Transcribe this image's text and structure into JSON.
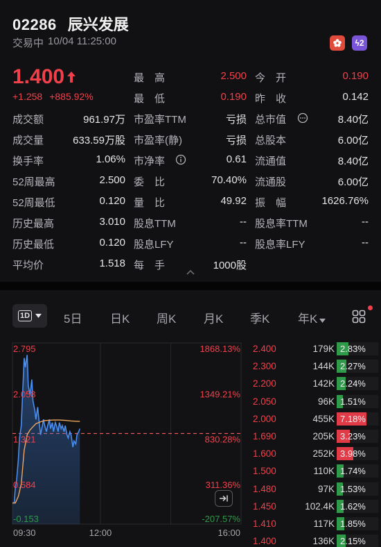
{
  "header": {
    "code": "02286",
    "name": "辰兴发展",
    "status": "交易中",
    "datetime": "10/04 11:25:00",
    "price": "1.400",
    "change": "+1.258",
    "change_pct": "+885.92%",
    "colors": {
      "up": "#f2404b",
      "down": "#2e9a4a",
      "badge_hk": "#e24b3c",
      "badge_lightning": "#7a55d8"
    }
  },
  "stats": {
    "col1": [
      {
        "label": "成交额",
        "value": "961.97万"
      },
      {
        "label": "成交量",
        "value": "633.59万股"
      },
      {
        "label": "换手率",
        "value": "1.06%"
      },
      {
        "label": "52周最高",
        "value": "2.500"
      },
      {
        "label": "52周最低",
        "value": "0.120"
      },
      {
        "label": "历史最高",
        "value": "3.010"
      },
      {
        "label": "历史最低",
        "value": "0.120"
      },
      {
        "label": "平均价",
        "value": "1.518"
      }
    ],
    "col2": [
      {
        "label": "最　高",
        "value": "2.500"
      },
      {
        "label": "最　低",
        "value": "0.190"
      },
      {
        "label": "市盈率TTM",
        "value": "亏损"
      },
      {
        "label": "市盈率(静)",
        "value": "亏损"
      },
      {
        "label": "市净率",
        "value": "0.61"
      },
      {
        "label": "委　比",
        "value": "70.40%"
      },
      {
        "label": "量　比",
        "value": "49.92"
      },
      {
        "label": "股息TTM",
        "value": "--"
      },
      {
        "label": "股息LFY",
        "value": "--"
      },
      {
        "label": "每　手",
        "value": "1000股"
      }
    ],
    "col3": [
      {
        "label": "今　开",
        "value": "0.190"
      },
      {
        "label": "昨　收",
        "value": "0.142"
      },
      {
        "label": "总市值",
        "value": "8.40亿"
      },
      {
        "label": "总股本",
        "value": "6.00亿"
      },
      {
        "label": "流通值",
        "value": "8.40亿"
      },
      {
        "label": "流通股",
        "value": "6.00亿"
      },
      {
        "label": "振　幅",
        "value": "1626.76%"
      },
      {
        "label": "股息率TTM",
        "value": "--"
      },
      {
        "label": "股息率LFY",
        "value": "--"
      }
    ]
  },
  "tabs": {
    "selected": "1D",
    "items": [
      "5日",
      "日K",
      "周K",
      "月K",
      "季K",
      "年K"
    ]
  },
  "chart_data": {
    "type": "line",
    "y_labels_left": [
      "2.795",
      "2.058",
      "1.321",
      "0.584",
      "-0.153"
    ],
    "y_labels_right": [
      "1868.13%",
      "1349.21%",
      "830.28%",
      "311.36%",
      "-207.57%"
    ],
    "x_labels": [
      "09:30",
      "12:00",
      "16:00"
    ],
    "ylim": [
      -0.153,
      2.795
    ],
    "prev_close": 1.321,
    "series": [
      {
        "x": [
          "09:30",
          "09:33",
          "09:35",
          "09:37",
          "09:40",
          "09:42",
          "09:45",
          "09:47",
          "09:50",
          "09:52",
          "09:55",
          "09:57",
          "10:00",
          "10:03",
          "10:05",
          "10:08",
          "10:10",
          "10:13",
          "10:15",
          "10:18",
          "10:20",
          "10:23",
          "10:25",
          "10:28",
          "10:30",
          "10:33",
          "10:35",
          "10:38",
          "10:40",
          "10:43",
          "10:45",
          "10:48",
          "10:50",
          "10:53",
          "10:55",
          "10:58",
          "11:00",
          "11:03",
          "11:05",
          "11:08",
          "11:10",
          "11:13",
          "11:15",
          "11:18",
          "11:20",
          "11:23",
          "11:25"
        ],
        "values": [
          0.19,
          0.19,
          0.45,
          0.55,
          0.9,
          1.25,
          1.45,
          1.9,
          2.55,
          2.4,
          2.6,
          2.1,
          1.95,
          2.2,
          1.85,
          1.7,
          1.55,
          1.75,
          1.55,
          1.3,
          1.4,
          1.55,
          1.45,
          1.35,
          1.45,
          1.55,
          1.4,
          1.5,
          1.35,
          1.5,
          1.45,
          1.35,
          1.5,
          1.4,
          1.45,
          1.35,
          1.45,
          1.3,
          1.25,
          1.35,
          1.3,
          1.1,
          1.2,
          1.15,
          1.3,
          1.35,
          1.4
        ]
      },
      {
        "x": [
          "09:30",
          "09:35",
          "09:40",
          "09:45",
          "09:50",
          "09:55",
          "10:00",
          "10:05",
          "10:10",
          "10:15",
          "10:20",
          "10:25",
          "10:30",
          "10:40",
          "10:50",
          "11:00",
          "11:10",
          "11:20",
          "11:25"
        ],
        "values": [
          0.19,
          0.19,
          0.3,
          0.5,
          1.05,
          1.3,
          1.38,
          1.43,
          1.48,
          1.5,
          1.52,
          1.53,
          1.535,
          1.54,
          1.54,
          1.535,
          1.525,
          1.52,
          1.518
        ]
      }
    ]
  },
  "order_book": [
    {
      "price": "2.400",
      "volume": "179K",
      "pct": "2.83%",
      "fill": 0.28
    },
    {
      "price": "2.300",
      "volume": "144K",
      "pct": "2.27%",
      "fill": 0.23
    },
    {
      "price": "2.200",
      "volume": "142K",
      "pct": "2.24%",
      "fill": 0.22
    },
    {
      "price": "2.050",
      "volume": "96K",
      "pct": "1.51%",
      "fill": 0.15
    },
    {
      "price": "2.000",
      "volume": "455K",
      "pct": "7.18%",
      "fill": 0.72
    },
    {
      "price": "1.690",
      "volume": "205K",
      "pct": "3.23%",
      "fill": 0.32
    },
    {
      "price": "1.600",
      "volume": "252K",
      "pct": "3.98%",
      "fill": 0.4
    },
    {
      "price": "1.500",
      "volume": "110K",
      "pct": "1.74%",
      "fill": 0.17
    },
    {
      "price": "1.480",
      "volume": "97K",
      "pct": "1.53%",
      "fill": 0.15
    },
    {
      "price": "1.450",
      "volume": "102.4K",
      "pct": "1.62%",
      "fill": 0.16
    },
    {
      "price": "1.410",
      "volume": "117K",
      "pct": "1.85%",
      "fill": 0.19
    },
    {
      "price": "1.400",
      "volume": "136K",
      "pct": "2.15%",
      "fill": 0.21
    }
  ],
  "icons": {
    "badge_hk": "hk-flower-icon",
    "badge_lightning": "lightning-icon",
    "info_circle": "info-icon",
    "collapse": "chevron-up-icon",
    "grid": "grid-icon",
    "play": "jump-to-latest-icon"
  },
  "badge_text": {
    "lightning": "ϟ2"
  }
}
